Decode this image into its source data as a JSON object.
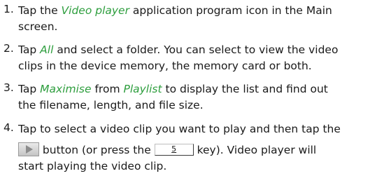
{
  "steps": [
    {
      "number": "1.",
      "line1": {
        "pre": "Tap the ",
        "link": "Video player",
        "post": " application program icon in the Main"
      },
      "line2": "screen."
    },
    {
      "number": "2.",
      "line1": {
        "pre": "Tap ",
        "link": "All",
        "post": " and select a folder. You can select to view the video"
      },
      "line2": "clips in the device memory, the memory card or both."
    },
    {
      "number": "3.",
      "line1": {
        "pre": "Tap ",
        "link1": "Maximise",
        "mid": " from ",
        "link2": "Playlist",
        "post": " to display the list and find out"
      },
      "line2": "the filename, length, and file size."
    },
    {
      "number": "4.",
      "line1": "Tap to select a video clip you want to play and then tap the",
      "line2": {
        "before_button": " button (or press the ",
        "key_label": "5",
        "after_key": " key). Video player will"
      },
      "line3": "start playing the video clip."
    }
  ],
  "colors": {
    "link": "#2e9e3e",
    "text": "#1a1a1a"
  },
  "icons": {
    "play_button": "play-triangle-icon",
    "key": "keypad-5-key-icon"
  }
}
